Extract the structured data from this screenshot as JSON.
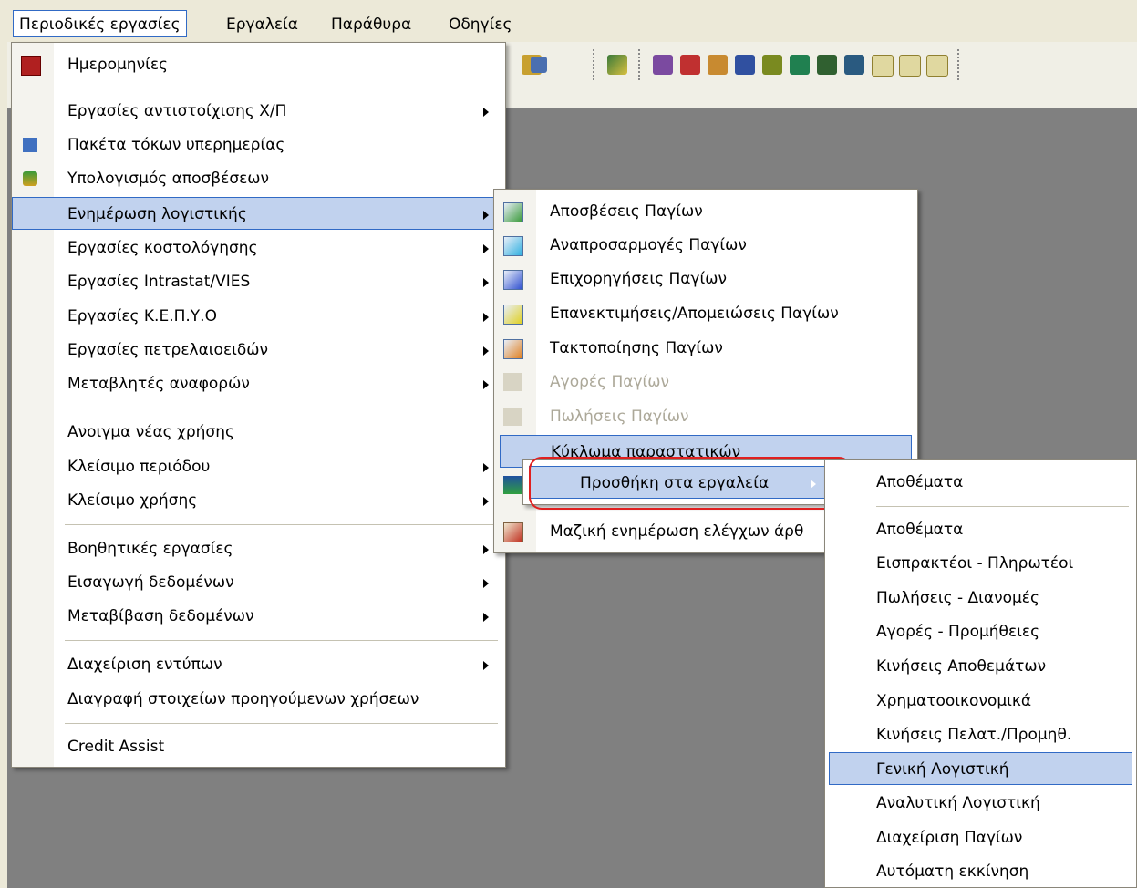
{
  "menubar": {
    "items": [
      {
        "label": "Περιοδικές εργασίες",
        "active": true
      },
      {
        "label": "Εργαλεία"
      },
      {
        "label": "Παράθυρα"
      },
      {
        "label": "Οδηγίες"
      }
    ]
  },
  "main_menu": {
    "items": [
      {
        "label": "Ημερομηνίες",
        "icon": "calendar-icon"
      },
      {
        "label": "Εργασίες αντιστοίχισης Χ/Π",
        "submenu": true
      },
      {
        "label": "Πακέτα τόκων υπερημερίας",
        "icon": "interest-package-icon"
      },
      {
        "label": "Υπολογισμός αποσβέσεων",
        "icon": "depreciation-icon"
      },
      {
        "label": "Ενημέρωση λογιστικής",
        "submenu": true,
        "highlighted": true
      },
      {
        "label": "Εργασίες κοστολόγησης",
        "submenu": true
      },
      {
        "label": "Εργασίες Intrastat/VIES",
        "submenu": true
      },
      {
        "label": "Εργασίες Κ.Ε.Π.Υ.Ο",
        "submenu": true
      },
      {
        "label": "Εργασίες πετρελαιοειδών",
        "submenu": true
      },
      {
        "label": "Μεταβλητές αναφορών",
        "submenu": true
      },
      {
        "label": "Ανοιγμα νέας χρήσης"
      },
      {
        "label": "Κλείσιμο περιόδου",
        "submenu": true
      },
      {
        "label": "Κλείσιμο χρήσης",
        "submenu": true
      },
      {
        "label": "Βοηθητικές εργασίες",
        "submenu": true
      },
      {
        "label": "Εισαγωγή δεδομένων",
        "submenu": true
      },
      {
        "label": "Μεταβίβαση δεδομένων",
        "submenu": true
      },
      {
        "label": "Διαχείριση εντύπων",
        "submenu": true
      },
      {
        "label": "Διαγραφή στοιχείων προηγούμενων χρήσεων"
      },
      {
        "label": "Credit Assist"
      }
    ]
  },
  "sub_menu": {
    "items": [
      {
        "label": "Αποσβέσεις Παγίων",
        "icon": "asset-depreciation-icon"
      },
      {
        "label": "Αναπροσαρμογές Παγίων",
        "icon": "asset-revaluation-icon"
      },
      {
        "label": "Επιχορηγήσεις Παγίων",
        "icon": "asset-grants-icon"
      },
      {
        "label": "Επανεκτιμήσεις/Απομειώσεις Παγίων",
        "icon": "asset-impairment-icon"
      },
      {
        "label": "Τακτοποίησης Παγίων",
        "icon": "asset-settlement-icon"
      },
      {
        "label": "Αγορές Παγίων",
        "icon": "asset-purchases-icon",
        "disabled": true
      },
      {
        "label": "Πωλήσεις Παγίων",
        "icon": "asset-sales-icon",
        "disabled": true
      },
      {
        "label": "Κύκλωμα παραστατικών",
        "highlighted": true
      },
      {
        "label": "",
        "icon": "document-update-icon"
      },
      {
        "label": "Μαζική ενημέρωση ελέγχων άρθ",
        "icon": "mass-update-icon"
      }
    ]
  },
  "context_popup": {
    "label": "Προσθήκη στα εργαλεία"
  },
  "tools_menu": {
    "header": "Αποθέματα",
    "items": [
      {
        "label": "Αποθέματα"
      },
      {
        "label": "Εισπρακτέοι - Πληρωτέοι"
      },
      {
        "label": "Πωλήσεις - Διανομές"
      },
      {
        "label": "Αγορές - Προμήθειες"
      },
      {
        "label": "Κινήσεις Αποθεμάτων"
      },
      {
        "label": "Χρηματοοικονομικά"
      },
      {
        "label": "Κινήσεις Πελατ./Προμηθ."
      },
      {
        "label": "Γενική Λογιστική",
        "highlighted": true
      },
      {
        "label": "Αναλυτική Λογιστική"
      },
      {
        "label": "Διαχείριση Παγίων"
      },
      {
        "label": "Αυτόματη εκκίνηση"
      }
    ]
  },
  "colors": {
    "highlight": "#c1d2ee",
    "highlight_border": "#316ac5",
    "workspace": "#808080",
    "annotation": "#e02020"
  }
}
